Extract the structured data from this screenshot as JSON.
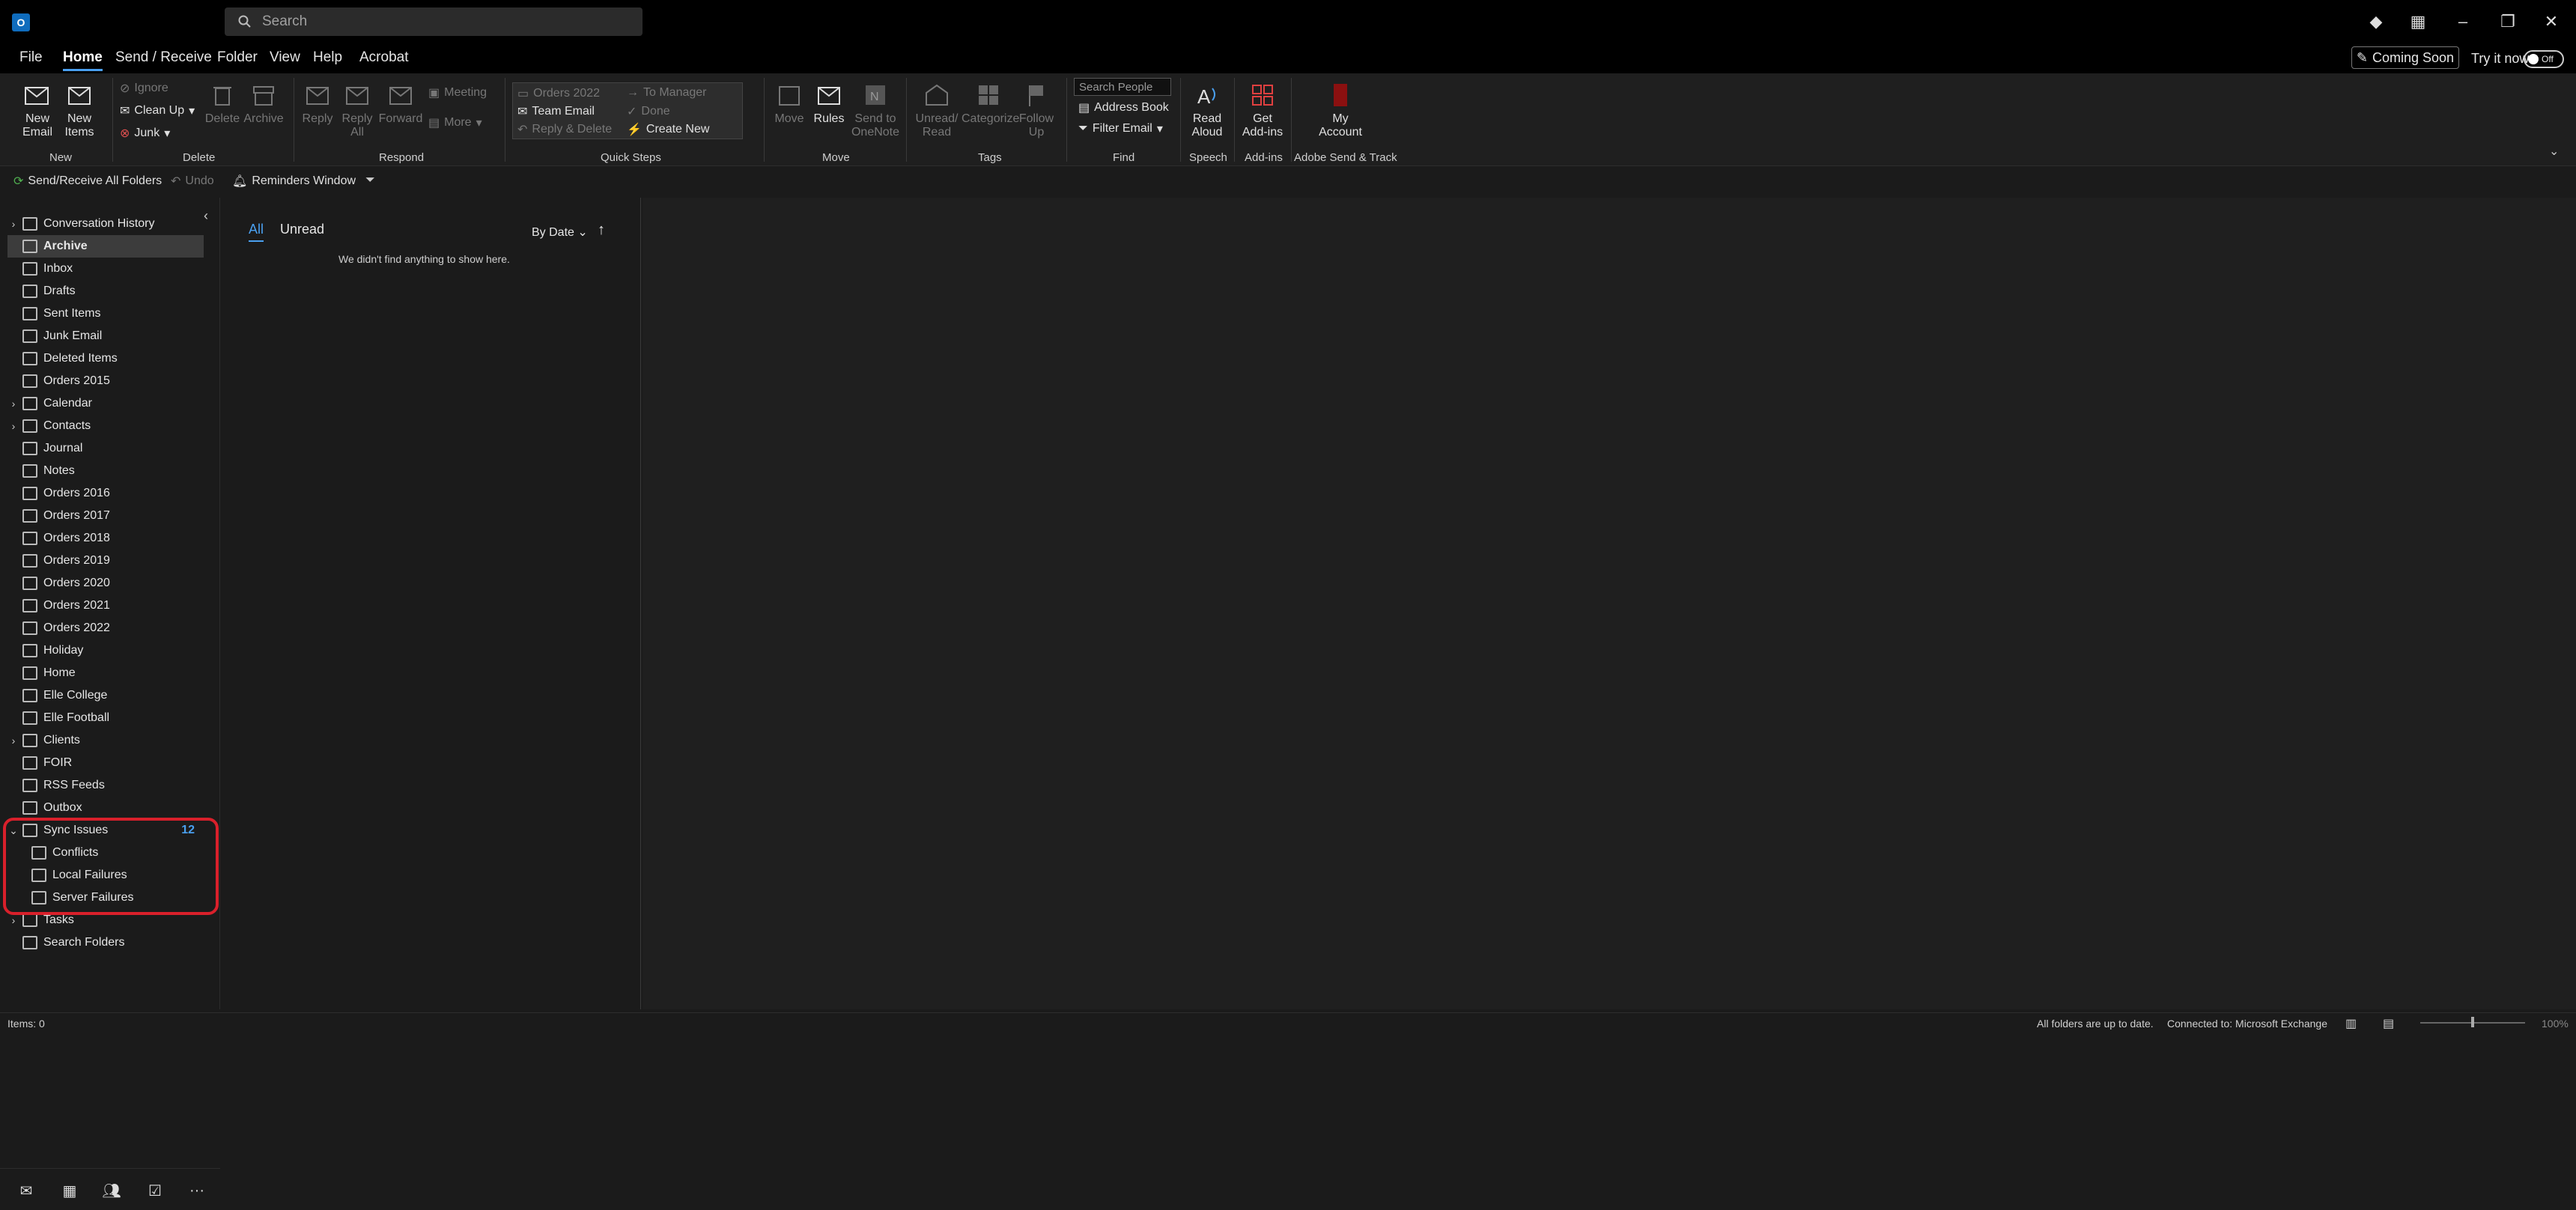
{
  "titlebar": {
    "app_icon": "outlook-icon",
    "search_placeholder": "Search",
    "icons": [
      "diamond-icon",
      "layout-icon",
      "minimize-icon",
      "restore-icon",
      "close-icon"
    ]
  },
  "menu": {
    "items": [
      "File",
      "Home",
      "Send / Receive",
      "Folder",
      "View",
      "Help",
      "Acrobat"
    ],
    "active": "Home",
    "coming_soon": "Coming Soon",
    "try_now": "Try it now",
    "toggle_label": "Off"
  },
  "ribbon": {
    "new": {
      "new_email": "New\nEmail",
      "new_items": "New\nItems",
      "group": "New"
    },
    "delete": {
      "ignore": "Ignore",
      "clean_up": "Clean Up",
      "junk": "Junk",
      "delete": "Delete",
      "archive": "Archive",
      "group": "Delete"
    },
    "respond": {
      "reply": "Reply",
      "reply_all": "Reply\nAll",
      "forward": "Forward",
      "meeting": "Meeting",
      "more": "More",
      "group": "Respond"
    },
    "quick_steps": {
      "items": [
        "Orders 2022",
        "Team Email",
        "Reply & Delete",
        "To Manager",
        "Done",
        "Create New"
      ],
      "group": "Quick Steps"
    },
    "move": {
      "move": "Move",
      "rules": "Rules",
      "onenote": "Send to\nOneNote",
      "group": "Move"
    },
    "tags": {
      "unread_read": "Unread/\nRead",
      "categorize": "Categorize",
      "follow_up": "Follow\nUp",
      "group": "Tags"
    },
    "find": {
      "search_people": "Search People",
      "address_book": "Address Book",
      "filter_email": "Filter Email",
      "group": "Find"
    },
    "speech": {
      "read_aloud": "Read\nAloud",
      "group": "Speech"
    },
    "addins": {
      "get_addins": "Get\nAdd-ins",
      "group": "Add-ins"
    },
    "adobe": {
      "my_account": "My\nAccount",
      "group": "Adobe Send & Track"
    }
  },
  "qat": {
    "send_receive_all": "Send/Receive All Folders",
    "undo": "Undo",
    "reminders": "Reminders Window"
  },
  "folders": [
    {
      "label": "Conversation History",
      "expandable": true
    },
    {
      "label": "Archive",
      "selected": true
    },
    {
      "label": "Inbox"
    },
    {
      "label": "Drafts"
    },
    {
      "label": "Sent Items"
    },
    {
      "label": "Junk Email"
    },
    {
      "label": "Deleted Items"
    },
    {
      "label": "Orders 2015"
    },
    {
      "label": "Calendar",
      "expandable": true
    },
    {
      "label": "Contacts",
      "expandable": true
    },
    {
      "label": "Journal"
    },
    {
      "label": "Notes"
    },
    {
      "label": "Orders 2016"
    },
    {
      "label": "Orders 2017"
    },
    {
      "label": "Orders 2018"
    },
    {
      "label": "Orders 2019"
    },
    {
      "label": "Orders 2020"
    },
    {
      "label": "Orders 2021"
    },
    {
      "label": "Orders 2022"
    },
    {
      "label": "Holiday"
    },
    {
      "label": "Home"
    },
    {
      "label": "Elle College"
    },
    {
      "label": "Elle Football"
    },
    {
      "label": "Clients",
      "expandable": true
    },
    {
      "label": "FOIR"
    },
    {
      "label": "RSS Feeds"
    },
    {
      "label": "Outbox"
    },
    {
      "label": "Sync Issues",
      "expanded": true,
      "count": "12"
    },
    {
      "label": "Conflicts",
      "child": true
    },
    {
      "label": "Local Failures",
      "child": true
    },
    {
      "label": "Server Failures",
      "child": true
    },
    {
      "label": "Tasks",
      "expandable": true
    },
    {
      "label": "Search Folders"
    }
  ],
  "message_list": {
    "tab_all": "All",
    "tab_unread": "Unread",
    "sort": "By Date",
    "empty": "We didn't find anything to show here."
  },
  "status": {
    "items": "Items: 0",
    "up_to_date": "All folders are up to date.",
    "connected": "Connected to: Microsoft Exchange",
    "zoom": "100%"
  },
  "colors": {
    "accent": "#4aa0f0",
    "highlight": "#d9202b"
  }
}
